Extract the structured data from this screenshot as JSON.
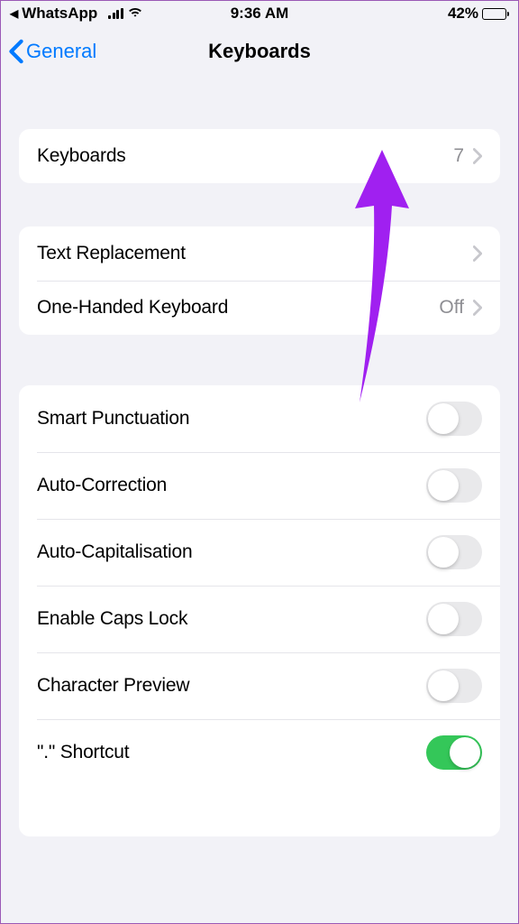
{
  "statusBar": {
    "backApp": "WhatsApp",
    "time": "9:36 AM",
    "batteryPercent": "42%"
  },
  "nav": {
    "backLabel": "General",
    "title": "Keyboards"
  },
  "sections": {
    "keyboards": {
      "label": "Keyboards",
      "count": "7"
    },
    "textReplacement": {
      "label": "Text Replacement"
    },
    "oneHanded": {
      "label": "One-Handed Keyboard",
      "value": "Off"
    }
  },
  "toggles": [
    {
      "label": "Smart Punctuation",
      "on": false
    },
    {
      "label": "Auto-Correction",
      "on": false
    },
    {
      "label": "Auto-Capitalisation",
      "on": false
    },
    {
      "label": "Enable Caps Lock",
      "on": false
    },
    {
      "label": "Character Preview",
      "on": false
    },
    {
      "label": "\".\" Shortcut",
      "on": true
    }
  ],
  "colors": {
    "accent": "#007aff",
    "toggleOn": "#34c759",
    "annotationArrow": "#9b30ff"
  }
}
